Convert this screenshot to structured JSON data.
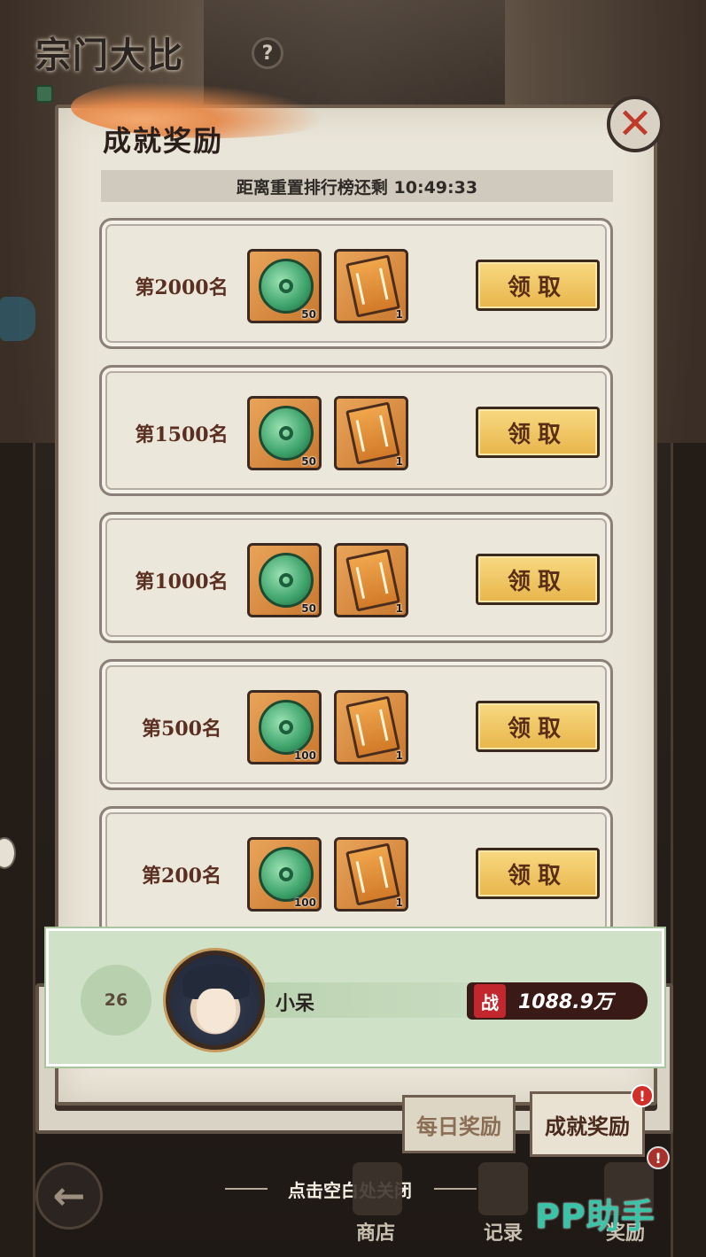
{
  "header": {
    "title": "宗门大比",
    "help_glyph": "?"
  },
  "panel": {
    "title": "成就奖励",
    "close_glyph": "✕",
    "timer_text": "距离重置排行榜还剩 10:49:33"
  },
  "rewards": [
    {
      "rank": "第2000名",
      "items": [
        {
          "icon": "jade-dragon-coin",
          "count": "50"
        },
        {
          "icon": "manual-book",
          "count": "1"
        }
      ],
      "button": "领取"
    },
    {
      "rank": "第1500名",
      "items": [
        {
          "icon": "jade-dragon-coin",
          "count": "50"
        },
        {
          "icon": "manual-book",
          "count": "1"
        }
      ],
      "button": "领取"
    },
    {
      "rank": "第1000名",
      "items": [
        {
          "icon": "jade-dragon-coin",
          "count": "50"
        },
        {
          "icon": "manual-book",
          "count": "1"
        }
      ],
      "button": "领取"
    },
    {
      "rank": "第500名",
      "items": [
        {
          "icon": "jade-dragon-coin",
          "count": "100"
        },
        {
          "icon": "manual-book",
          "count": "1"
        }
      ],
      "button": "领取"
    },
    {
      "rank": "第200名",
      "items": [
        {
          "icon": "jade-dragon-coin",
          "count": "100"
        },
        {
          "icon": "manual-book",
          "count": "1"
        }
      ],
      "button": "领取"
    }
  ],
  "player": {
    "rank": "26",
    "name": "小呆",
    "power_badge": "战",
    "power": "1088.9万"
  },
  "tabs": {
    "daily": "每日奖励",
    "achievement": "成就奖励",
    "alert_glyph": "!"
  },
  "close_hint": "点击空白处关闭",
  "bottom_nav": {
    "back_glyph": "←",
    "shop": "商店",
    "records": "记录",
    "rewards": "奖励"
  },
  "watermark": "PP助手",
  "colors": {
    "panel_bg": "#e9e5d8",
    "claim_button": "#f0c865",
    "player_bar": "#cfe2c8",
    "power_badge": "#c1272d",
    "watermark": "#39c3a7"
  }
}
